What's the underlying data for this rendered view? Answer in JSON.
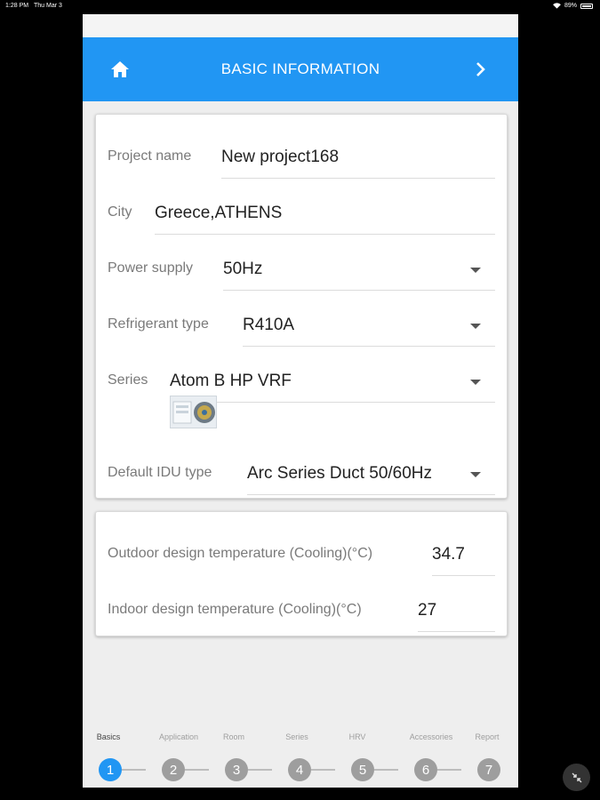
{
  "status_bar": {
    "time": "1:28 PM",
    "date": "Thu Mar 3",
    "battery": "89%"
  },
  "header": {
    "title": "BASIC INFORMATION",
    "home_icon": "home-icon",
    "next_icon": "chevron-right-icon"
  },
  "basic_info": {
    "project_name": {
      "label": "Project name",
      "value": "New project168"
    },
    "city": {
      "label": "City",
      "value": "Greece,ATHENS"
    },
    "power_supply": {
      "label": "Power supply",
      "value": "50Hz"
    },
    "refrigerant_type": {
      "label": "Refrigerant type",
      "value": "R410A"
    },
    "series": {
      "label": "Series",
      "value": "Atom B HP VRF"
    },
    "default_idu_type": {
      "label": "Default IDU type",
      "value": "Arc Series Duct 50/60Hz"
    }
  },
  "design_temps": {
    "outdoor": {
      "label": "Outdoor design temperature (Cooling)(°C)",
      "value": "34.7"
    },
    "indoor": {
      "label": "Indoor design temperature (Cooling)(°C)",
      "value": "27"
    }
  },
  "steps": [
    {
      "label": "Basics",
      "number": "1",
      "active": true
    },
    {
      "label": "Application",
      "number": "2",
      "active": false
    },
    {
      "label": "Room",
      "number": "3",
      "active": false
    },
    {
      "label": "Series",
      "number": "4",
      "active": false
    },
    {
      "label": "HRV",
      "number": "5",
      "active": false
    },
    {
      "label": "Accessories",
      "number": "6",
      "active": false
    },
    {
      "label": "Report",
      "number": "7",
      "active": false
    }
  ],
  "colors": {
    "primary": "#2196f3",
    "inactive_step": "#9e9e9e"
  }
}
